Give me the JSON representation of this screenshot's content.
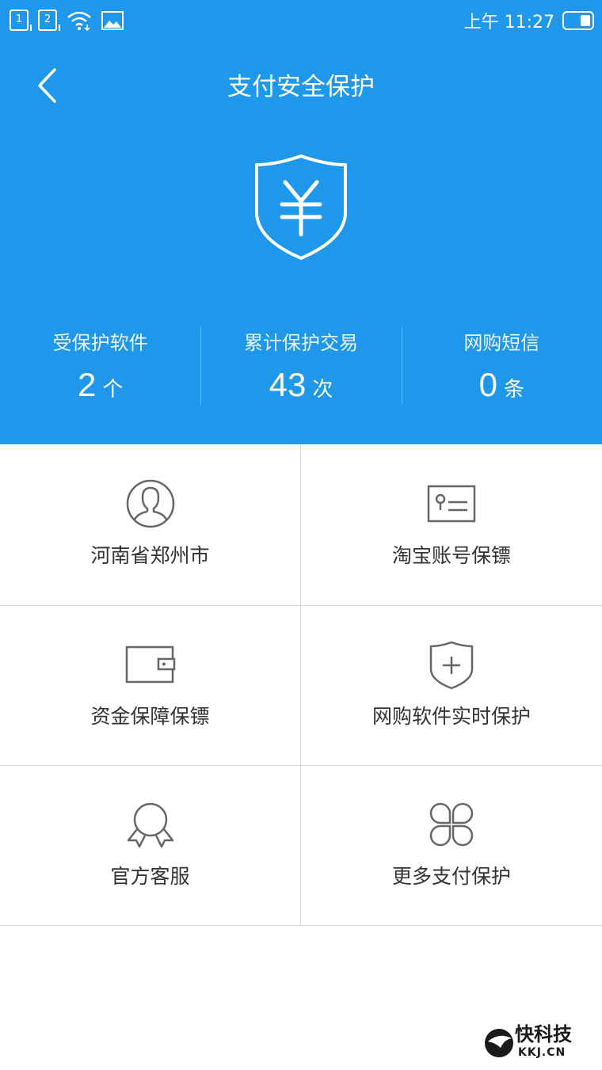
{
  "status_bar": {
    "sim1": "1",
    "sim2": "2",
    "time": "上午 11:27"
  },
  "header": {
    "title": "支付安全保护",
    "background_color": "#1f97ea"
  },
  "stats": [
    {
      "label": "受保护软件",
      "value": "2",
      "unit": "个"
    },
    {
      "label": "累计保护交易",
      "value": "43",
      "unit": "次"
    },
    {
      "label": "网购短信",
      "value": "0",
      "unit": "条"
    }
  ],
  "grid": [
    {
      "label": "河南省郑州市",
      "icon": "user-avatar-icon"
    },
    {
      "label": "淘宝账号保镖",
      "icon": "id-card-icon"
    },
    {
      "label": "资金保障保镖",
      "icon": "wallet-icon"
    },
    {
      "label": "网购软件实时保护",
      "icon": "shield-plus-icon"
    },
    {
      "label": "官方客服",
      "icon": "award-badge-icon"
    },
    {
      "label": "更多支付保护",
      "icon": "four-leaf-clover-icon"
    }
  ],
  "watermark": {
    "text": "快科技",
    "domain": "KKJ.CN"
  }
}
